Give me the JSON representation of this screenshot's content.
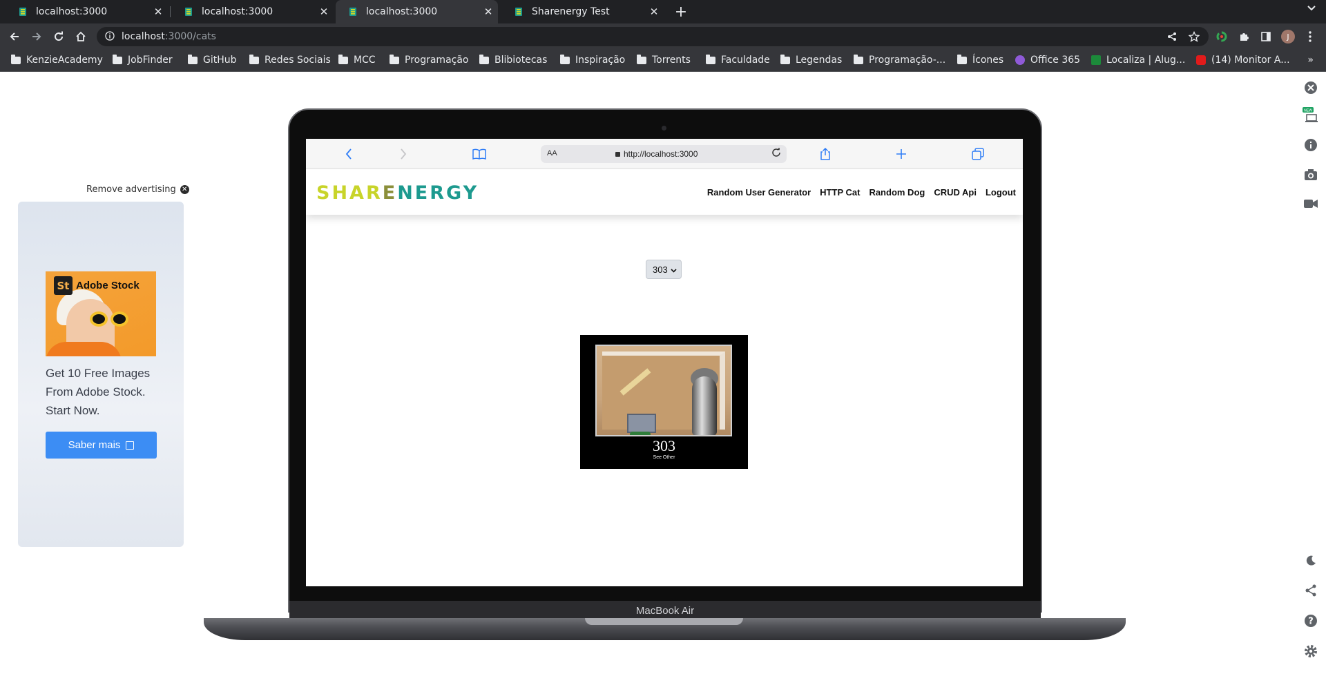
{
  "browser": {
    "tabs": [
      {
        "title": "localhost:3000",
        "active": false
      },
      {
        "title": "localhost:3000",
        "active": false
      },
      {
        "title": "localhost:3000",
        "active": true
      },
      {
        "title": "Sharenergy Test",
        "active": false
      }
    ],
    "address": {
      "host": "localhost",
      "path": ":3000/cats"
    },
    "bookmarks": [
      {
        "label": "KenzieAcademy",
        "type": "folder"
      },
      {
        "label": "JobFinder",
        "type": "folder"
      },
      {
        "label": "GitHub",
        "type": "folder"
      },
      {
        "label": "Redes Sociais",
        "type": "folder"
      },
      {
        "label": "MCC",
        "type": "folder"
      },
      {
        "label": "Programação",
        "type": "folder"
      },
      {
        "label": "Blibiotecas",
        "type": "folder"
      },
      {
        "label": "Inspiração",
        "type": "folder"
      },
      {
        "label": "Torrents",
        "type": "folder"
      },
      {
        "label": "Faculdade",
        "type": "folder"
      },
      {
        "label": "Legendas",
        "type": "folder"
      },
      {
        "label": "Programação-...",
        "type": "folder"
      },
      {
        "label": "Ícones",
        "type": "folder"
      },
      {
        "label": "Office 365",
        "type": "site",
        "color": "#8f5ad8"
      },
      {
        "label": "Localiza | Alug...",
        "type": "site",
        "color": "#1c8a3a"
      },
      {
        "label": "(14) Monitor A...",
        "type": "site",
        "color": "#e21b1b"
      }
    ],
    "bookmarks_more": "»",
    "profile_initial": "J"
  },
  "ad": {
    "remove_label": "Remove advertising",
    "brand_badge": "St",
    "brand_name": "Adobe Stock",
    "text": "Get 10 Free Images From Adobe Stock. Start Now.",
    "button_label": "Saber mais"
  },
  "sidebar": {
    "new_badge": "NEW"
  },
  "mockup": {
    "device_label": "MacBook Air",
    "safari": {
      "aa_label": "AA",
      "url": "http://localhost:3000"
    },
    "site": {
      "logo_parts": [
        "SHAR",
        "E",
        "NERGY"
      ],
      "nav": [
        "Random User Generator",
        "HTTP Cat",
        "Random Dog",
        "CRUD Api",
        "Logout"
      ],
      "select_value": "303",
      "cat_code": "303",
      "cat_message": "See Other"
    }
  },
  "colors": {
    "tab_bg": "#202124",
    "toolbar_bg": "#35363a",
    "ad_button": "#3c8df4",
    "logo_yellow": "#c8d42a",
    "logo_teal": "#1d9a8f"
  }
}
